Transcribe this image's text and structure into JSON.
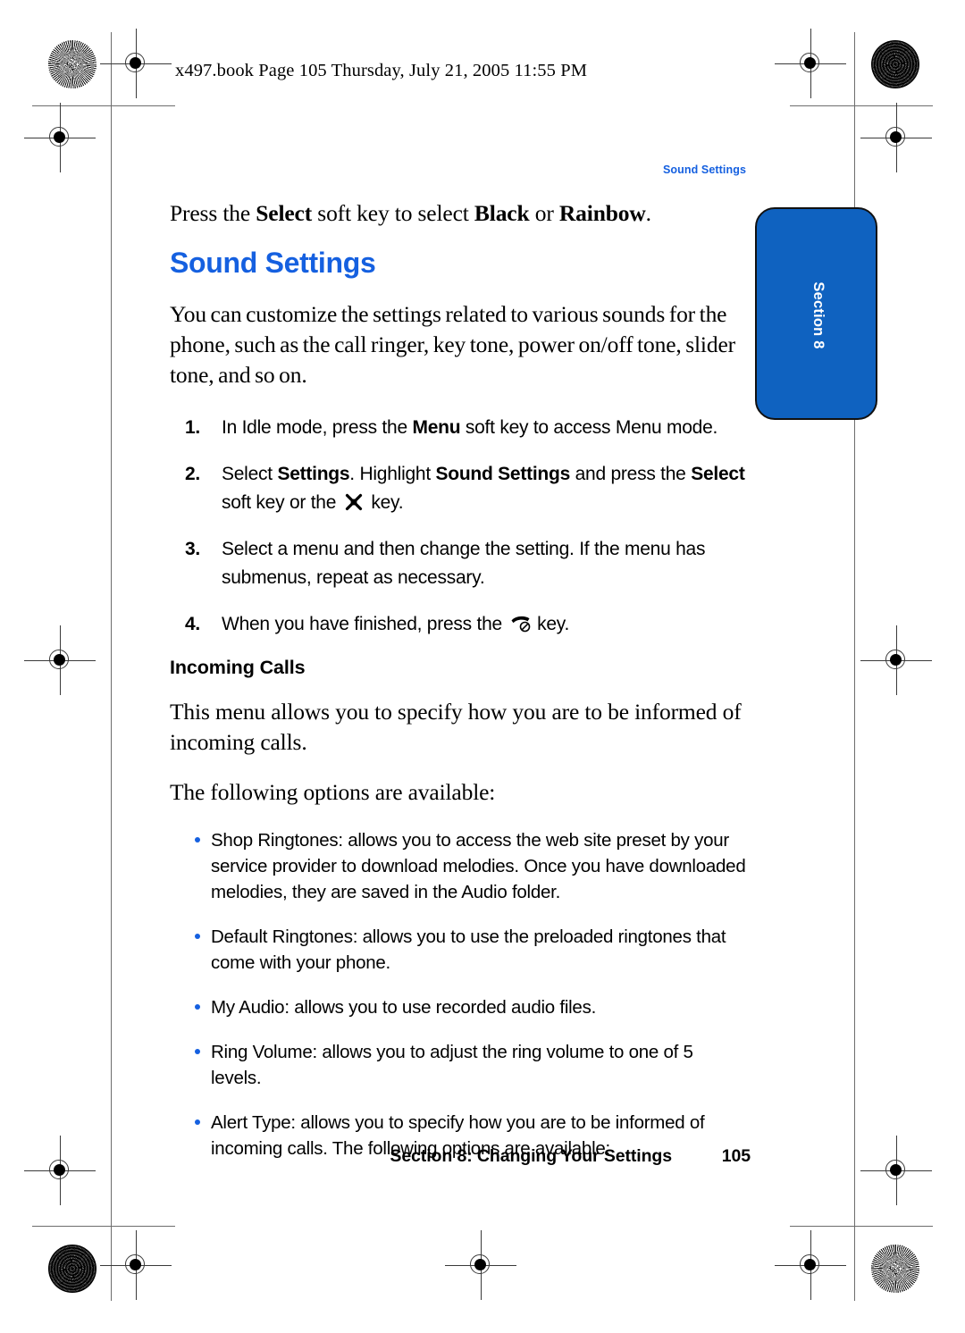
{
  "print_marks": {
    "file_stamp": "x497.book  Page 105  Thursday, July 21, 2005  11:55 PM",
    "icons": {
      "registration": "registration-target-icon",
      "starburst": "starburst-resolution-target-icon",
      "halftone": "halftone-density-target-icon"
    }
  },
  "running_head": "Sound Settings",
  "section_tab": {
    "label": "Section 8"
  },
  "content": {
    "lead_paragraph": {
      "before": "Press the ",
      "bold1": "Select",
      "middle": " soft key to select ",
      "bold2": "Black",
      "conjunction": " or ",
      "bold3": "Rainbow",
      "after": "."
    },
    "title": "Sound Settings",
    "intro": "You can customize the settings related to various sounds for the phone, such as the call ringer, key tone, power on/off tone, slider tone, and so on.",
    "steps": [
      {
        "num": "1.",
        "parts": [
          {
            "t": "In Idle mode, press the ",
            "b": false
          },
          {
            "t": "Menu",
            "b": true
          },
          {
            "t": " soft key to access Menu mode.",
            "b": false
          }
        ]
      },
      {
        "num": "2.",
        "parts": [
          {
            "t": "Select ",
            "b": false
          },
          {
            "t": "Settings",
            "b": true
          },
          {
            "t": ". Highlight ",
            "b": false
          },
          {
            "t": "Sound Settings",
            "b": true
          },
          {
            "t": " and press the ",
            "b": false
          },
          {
            "t": "Select",
            "b": true
          },
          {
            "t": " soft key or the ",
            "b": false
          },
          {
            "icon": "navigation-ok-key-icon"
          },
          {
            "t": " key.",
            "b": false
          }
        ]
      },
      {
        "num": "3.",
        "parts": [
          {
            "t": "Select a menu and then change the setting. If the menu has submenus, repeat as necessary.",
            "b": false
          }
        ]
      },
      {
        "num": "4.",
        "parts": [
          {
            "t": "When you have finished, press the ",
            "b": false
          },
          {
            "icon": "end-call-key-icon"
          },
          {
            "t": " key.",
            "b": false
          }
        ]
      }
    ],
    "subhead": "Incoming Calls",
    "paragraph_1": "This menu allows you to specify how you are to be informed of incoming calls.",
    "paragraph_2": "The following options are available:",
    "bullets": [
      "Shop Ringtones: allows you to access the web site preset by your service provider to download melodies. Once you have downloaded melodies, they are saved in the Audio folder.",
      "Default Ringtones: allows you to use the preloaded ringtones that come with your phone.",
      "My Audio: allows you to use recorded audio files.",
      "Ring Volume: allows you to adjust the ring volume to one of 5 levels.",
      "Alert Type: allows you to specify how you are to be informed of incoming calls. The following options are available:"
    ]
  },
  "footer": {
    "title": "Section 8: Changing Your Settings",
    "page_number": "105"
  },
  "colors": {
    "accent_blue": "#1560e0",
    "tab_blue": "#0f62c0",
    "text_black": "#000000"
  }
}
